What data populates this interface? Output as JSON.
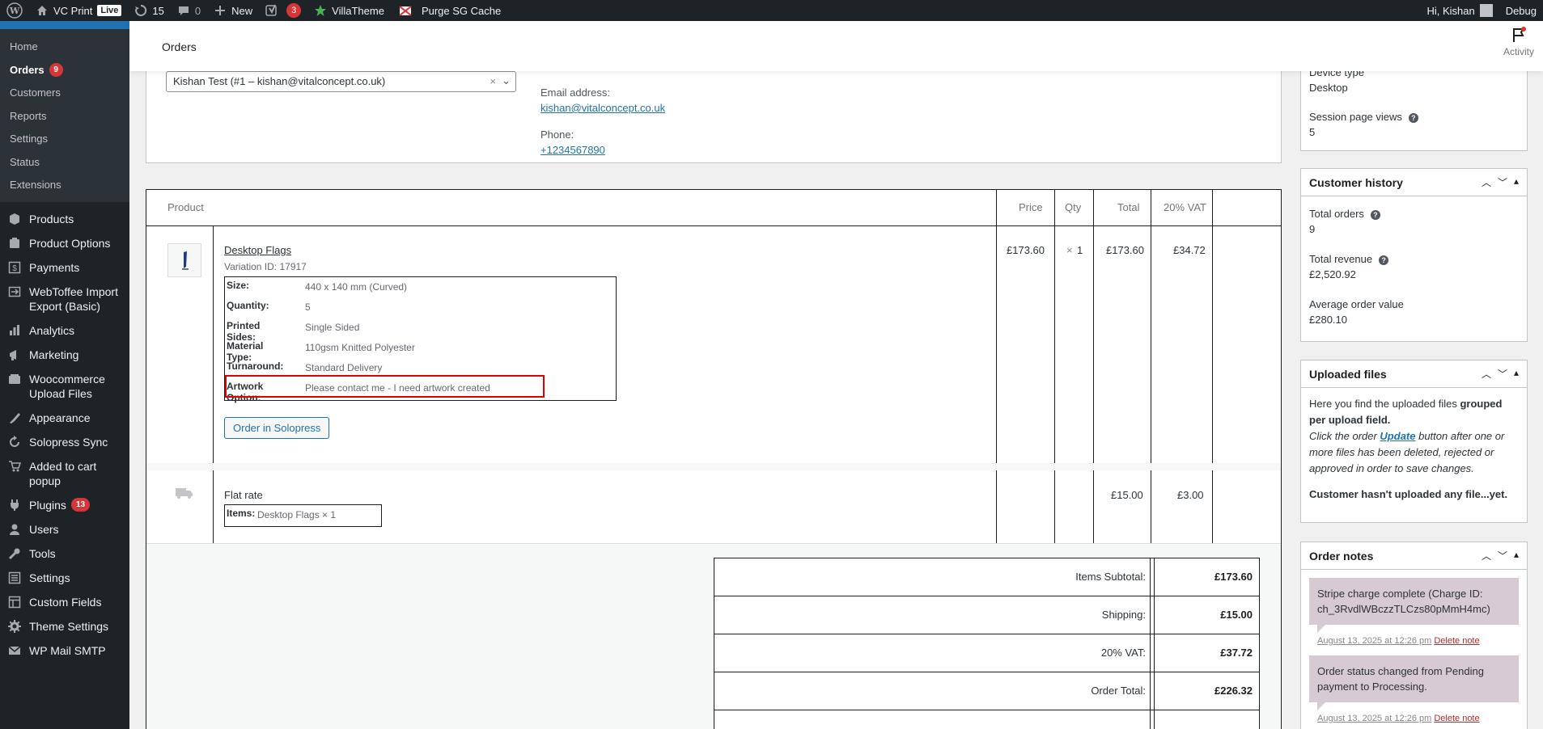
{
  "adminbar": {
    "site_name": "VC Print",
    "live_badge": "Live",
    "updates_count": "15",
    "comments_count": "0",
    "new_label": "New",
    "yoast_count": "3",
    "villatheme": "VillaTheme",
    "purge": "Purge SG Cache",
    "greeting": "Hi, Kishan",
    "debug": "Debug"
  },
  "sidebar": {
    "woo_sub": [
      {
        "label": "Home"
      },
      {
        "label": "Orders",
        "count": "9"
      },
      {
        "label": "Customers"
      },
      {
        "label": "Reports"
      },
      {
        "label": "Settings"
      },
      {
        "label": "Status"
      },
      {
        "label": "Extensions"
      }
    ],
    "menu": [
      {
        "label": "Products",
        "icon": "products-icon"
      },
      {
        "label": "Product Options",
        "icon": "product-options-icon"
      },
      {
        "label": "Payments",
        "icon": "payments-icon"
      },
      {
        "label": "WebToffee Import Export (Basic)",
        "icon": "import-export-icon"
      },
      {
        "label": "Analytics",
        "icon": "analytics-icon"
      },
      {
        "label": "Marketing",
        "icon": "marketing-icon"
      },
      {
        "label": "Woocommerce Upload Files",
        "icon": "upload-files-icon"
      },
      {
        "label": "Appearance",
        "icon": "appearance-icon"
      },
      {
        "label": "Solopress Sync",
        "icon": "sync-icon"
      },
      {
        "label": "Added to cart popup",
        "icon": "cart-icon"
      },
      {
        "label": "Plugins",
        "icon": "plugins-icon",
        "count": "13"
      },
      {
        "label": "Users",
        "icon": "users-icon"
      },
      {
        "label": "Tools",
        "icon": "tools-icon"
      },
      {
        "label": "Settings",
        "icon": "settings-icon"
      },
      {
        "label": "Custom Fields",
        "icon": "custom-fields-icon"
      },
      {
        "label": "Theme Settings",
        "icon": "theme-settings-icon"
      },
      {
        "label": "WP Mail SMTP",
        "icon": "mail-icon"
      }
    ]
  },
  "header": {
    "title": "Orders",
    "activity": "Activity"
  },
  "customer": {
    "select_value": "Kishan Test (#1 – kishan@vitalconcept.co.uk)",
    "email_label": "Email address:",
    "email": "kishan@vitalconcept.co.uk",
    "phone_label": "Phone:",
    "phone": "+1234567890"
  },
  "items": {
    "headers": {
      "product": "Product",
      "price": "Price",
      "qty": "Qty",
      "total": "Total",
      "vat": "20% VAT"
    },
    "product": {
      "name": "Desktop Flags",
      "variation_label": "Variation ID:",
      "variation_id": "17917",
      "price": "£173.60",
      "qty_x": "×",
      "qty": "1",
      "total": "£173.60",
      "vat": "£34.72",
      "meta": [
        {
          "key": "Size:",
          "value": "440 x 140 mm (Curved)"
        },
        {
          "key": "Quantity:",
          "value": "5"
        },
        {
          "key": "Printed Sides:",
          "value": "Single Sided"
        },
        {
          "key": "Material Type:",
          "value": "110gsm Knitted Polyester"
        },
        {
          "key": "Turnaround:",
          "value": "Standard Delivery"
        },
        {
          "key": "Artwork Option:",
          "value": "Please contact me - I need artwork created"
        }
      ],
      "button": "Order in Solopress"
    },
    "shipping": {
      "name": "Flat rate",
      "items_key": "Items:",
      "items_value": "Desktop Flags × 1",
      "total": "£15.00",
      "vat": "£3.00"
    }
  },
  "totals": [
    {
      "label": "Items Subtotal:",
      "value": "£173.60"
    },
    {
      "label": "Shipping:",
      "value": "£15.00"
    },
    {
      "label": "20% VAT:",
      "value": "£37.72"
    },
    {
      "label": "Order Total:",
      "value": "£226.32"
    }
  ],
  "right": {
    "device_label": "Device type",
    "device_value": "Desktop",
    "views_label": "Session page views",
    "views_value": "5",
    "history_title": "Customer history",
    "total_orders_label": "Total orders",
    "total_orders": "9",
    "total_revenue_label": "Total revenue",
    "total_revenue": "£2,520.92",
    "aov_label": "Average order value",
    "aov": "£280.10",
    "uploads_title": "Uploaded files",
    "uploads_text_1": "Here you find the uploaded files ",
    "uploads_text_bold": "grouped per upload field.",
    "uploads_text_2a": "Click the order ",
    "uploads_update": "Update",
    "uploads_text_2b": " button after one or more files has been deleted, rejected or approved in order to save changes.",
    "uploads_none": "Customer hasn't uploaded any file...yet.",
    "notes_title": "Order notes",
    "notes": [
      {
        "text": "Stripe charge complete (Charge ID: ch_3RvdlWBczzTLCzs80pMmH4mc)",
        "date": "August 13, 2025 at 12:26 pm",
        "delete": "Delete note"
      },
      {
        "text": "Order status changed from Pending payment to Processing.",
        "date": "August 13, 2025 at 12:26 pm",
        "delete": "Delete note"
      }
    ]
  },
  "colors": {
    "accent": "#2271b1",
    "admin_bg": "#1d2327",
    "badge": "#d63638",
    "highlight": "#e00000",
    "note_bg": "#d7cad2"
  }
}
